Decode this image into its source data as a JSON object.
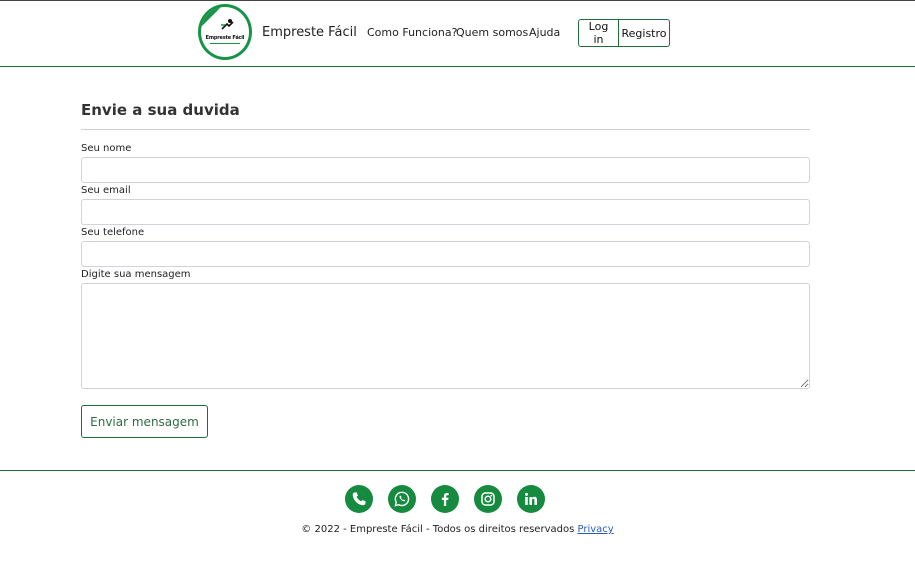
{
  "header": {
    "brand_name": "Empreste Fácil",
    "logo_text": "Empreste Fácil",
    "nav": {
      "how": "Como Funciona?",
      "about": "Quem somos",
      "help": "Ajuda"
    },
    "login_label": "Log in",
    "register_label": "Registro"
  },
  "form": {
    "title": "Envie a sua duvida",
    "name_label": "Seu nome",
    "name_value": "",
    "email_label": "Seu email",
    "email_value": "",
    "phone_label": "Seu telefone",
    "phone_value": "",
    "message_label": "Digite sua mensagem",
    "message_value": "",
    "submit_label": "Enviar mensagem"
  },
  "footer": {
    "social_icons": [
      "phone-icon",
      "whatsapp-icon",
      "facebook-icon",
      "instagram-icon",
      "linkedin-icon"
    ],
    "copyright": "© 2022 - Empreste Fácil - Todos os direitos reservados",
    "privacy_label": "Privacy"
  },
  "colors": {
    "brand_green": "#168a3f",
    "border_green": "#1e6e3a",
    "link_blue": "#2a5bb5"
  }
}
